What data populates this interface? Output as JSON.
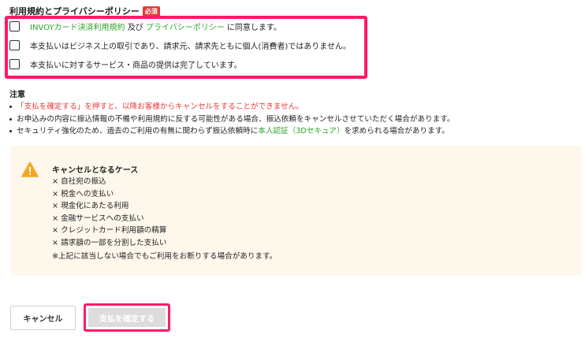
{
  "terms": {
    "title": "利用規約とプライバシーポリシー",
    "required_badge": "必須",
    "items": [
      {
        "link1": "INVOYカード決済利用規約",
        "mid": " 及び ",
        "link2": "プライバシーポリシー",
        "tail": " に同意します。"
      },
      {
        "text": "本支払いはビジネス上の取引であり、請求元、請求先ともに個人(消費者)ではありません。"
      },
      {
        "text": "本支払いに対するサービス・商品の提供は完了しています。"
      }
    ]
  },
  "notes": {
    "title": "注意",
    "items": [
      {
        "text": "「支払を確定する」を押すと、以降お客様からキャンセルをすることができません。"
      },
      {
        "text": "お申込みの内容に振込情報の不備や利用規約に反する可能性がある場合、振込依頼をキャンセルさせていただく場合があります。"
      },
      {
        "pre": "セキュリティ強化のため、過去のご利用の有無に関わらず振込依頼時に",
        "link": "本人認証（3Dセキュア）",
        "post": "を求められる場合があります。"
      }
    ]
  },
  "cancel_cases": {
    "icon": "warning-icon",
    "title": "キャンセルとなるケース",
    "items": [
      "× 自社宛の振込",
      "× 税金への支払い",
      "× 現金化にあたる利用",
      "× 金融サービスへの支払い",
      "× クレジットカード利用額の精算",
      "× 請求額の一部を分割した支払い"
    ],
    "note": "※上記に該当しない場合でもご利用をお断りする場合があります。"
  },
  "buttons": {
    "cancel_label": "キャンセル",
    "confirm_label": "支払を確定する"
  },
  "colors": {
    "highlight": "#ff1a66",
    "link_green": "#2aa62a",
    "warning_red": "#e53935",
    "panel_bg": "#fdf7ec",
    "warn_orange": "#f5a623"
  }
}
